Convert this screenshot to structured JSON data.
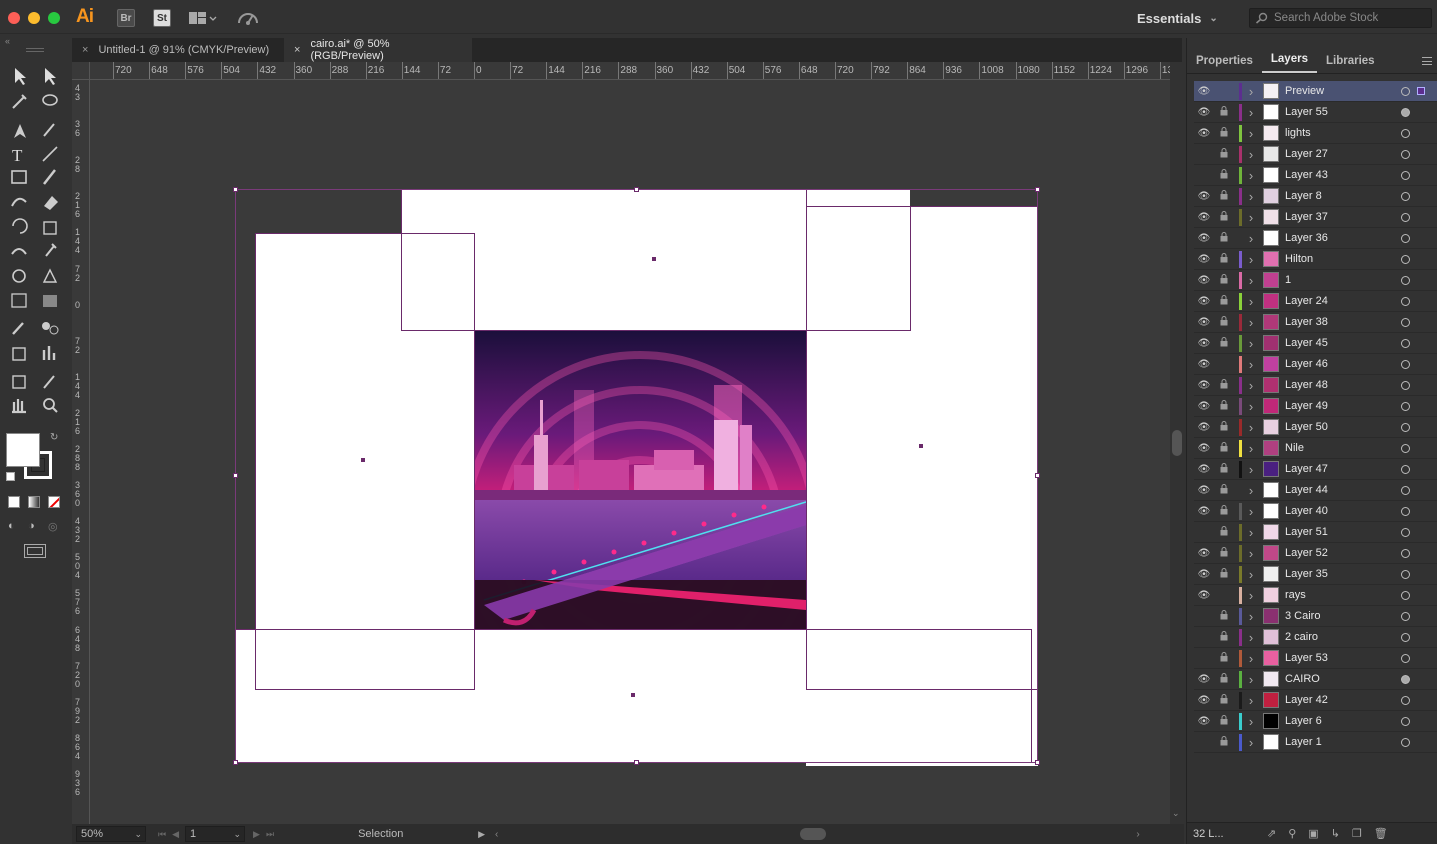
{
  "app": {
    "logo": "Ai",
    "bridge_label": "Br",
    "stock_label": "St",
    "workspace": "Essentials",
    "search_placeholder": "Search Adobe Stock"
  },
  "tabs": [
    {
      "label": "Untitled-1 @ 91% (CMYK/Preview)",
      "active": false
    },
    {
      "label": "cairo.ai* @ 50% (RGB/Preview)",
      "active": true
    }
  ],
  "ruler_h": [
    "720",
    "648",
    "576",
    "504",
    "432",
    "360",
    "288",
    "216",
    "144",
    "72",
    "0",
    "72",
    "144",
    "216",
    "288",
    "360",
    "432",
    "504",
    "576",
    "648",
    "720",
    "792",
    "864",
    "936",
    "1008",
    "1080",
    "1152",
    "1224",
    "1296",
    "13"
  ],
  "ruler_v": [
    "4 3",
    "3 6",
    "2 8",
    "2 1 6",
    "1 4 4",
    "7 2",
    "0",
    "7 2",
    "1 4 4",
    "2 1 6",
    "2 8 8",
    "3 6 0",
    "4 3 2",
    "5 0 4",
    "5 7 6",
    "6 4 8",
    "7 2 0",
    "7 9 2",
    "8 6 4",
    "9 3 6"
  ],
  "status": {
    "zoom": "50%",
    "artboard": "1",
    "tool": "Selection"
  },
  "panel": {
    "tabs": [
      "Properties",
      "Layers",
      "Libraries"
    ],
    "active_tab": "Layers",
    "layer_count": "32 L..."
  },
  "layers": [
    {
      "name": "Preview",
      "visible": true,
      "locked": false,
      "color": "#5c2e8f",
      "thumb": "#f4f0f4",
      "selected": true,
      "target": "open"
    },
    {
      "name": "Layer 55",
      "visible": true,
      "locked": true,
      "color": "#8a2f8a",
      "thumb": "#ffffff",
      "target": "filled"
    },
    {
      "name": "lights",
      "visible": true,
      "locked": true,
      "color": "#7fc43f",
      "thumb": "#f5eaf0",
      "target": "open"
    },
    {
      "name": "Layer 27",
      "visible": false,
      "locked": true,
      "color": "#a8316b",
      "thumb": "#e8e8e8",
      "target": "open"
    },
    {
      "name": "Layer 43",
      "visible": false,
      "locked": true,
      "color": "#6fb43a",
      "thumb": "#ffffff",
      "target": "open"
    },
    {
      "name": "Layer 8",
      "visible": true,
      "locked": true,
      "color": "#8a2f8a",
      "thumb": "#e0d0e0",
      "target": "open"
    },
    {
      "name": "Layer 37",
      "visible": true,
      "locked": true,
      "color": "#6c6c2a",
      "thumb": "#f0e0e8",
      "target": "open"
    },
    {
      "name": "Layer 36",
      "visible": true,
      "locked": true,
      "color": "#323232",
      "thumb": "#ffffff",
      "target": "open"
    },
    {
      "name": "Hilton",
      "visible": true,
      "locked": true,
      "color": "#7a5ccc",
      "thumb": "#e070b0",
      "target": "open"
    },
    {
      "name": "1",
      "visible": true,
      "locked": true,
      "color": "#d96aa5",
      "thumb": "#c04090",
      "target": "open"
    },
    {
      "name": "Layer 24",
      "visible": true,
      "locked": true,
      "color": "#8ad13a",
      "thumb": "#c03080",
      "target": "open"
    },
    {
      "name": "Layer 38",
      "visible": true,
      "locked": true,
      "color": "#9a2a3a",
      "thumb": "#b03878",
      "target": "open"
    },
    {
      "name": "Layer 45",
      "visible": true,
      "locked": true,
      "color": "#6a9a3a",
      "thumb": "#a03070",
      "target": "open"
    },
    {
      "name": "Layer 46",
      "visible": true,
      "locked": false,
      "color": "#e07a7a",
      "thumb": "#c040a0",
      "target": "open"
    },
    {
      "name": "Layer 48",
      "visible": true,
      "locked": true,
      "color": "#8a2f8a",
      "thumb": "#b03070",
      "target": "open"
    },
    {
      "name": "Layer 49",
      "visible": true,
      "locked": true,
      "color": "#7a4a7a",
      "thumb": "#c02878",
      "target": "open"
    },
    {
      "name": "Layer 50",
      "visible": true,
      "locked": true,
      "color": "#9a2a2a",
      "thumb": "#e8d0e0",
      "target": "open"
    },
    {
      "name": "Nile",
      "visible": true,
      "locked": true,
      "color": "#f0e040",
      "thumb": "#b04080",
      "target": "open"
    },
    {
      "name": "Layer 47",
      "visible": true,
      "locked": true,
      "color": "#111111",
      "thumb": "#4a2080",
      "target": "open"
    },
    {
      "name": "Layer 44",
      "visible": true,
      "locked": true,
      "color": "#323232",
      "thumb": "#ffffff",
      "target": "open"
    },
    {
      "name": "Layer 40",
      "visible": true,
      "locked": true,
      "color": "#5a5a5a",
      "thumb": "#ffffff",
      "target": "open"
    },
    {
      "name": "Layer 51",
      "visible": false,
      "locked": true,
      "color": "#6c6c2a",
      "thumb": "#f0d8e8",
      "target": "open"
    },
    {
      "name": "Layer 52",
      "visible": true,
      "locked": true,
      "color": "#6c6c2a",
      "thumb": "#c04888",
      "target": "open"
    },
    {
      "name": "Layer 35",
      "visible": true,
      "locked": true,
      "color": "#7a7a2a",
      "thumb": "#f0f0f0",
      "target": "open"
    },
    {
      "name": "rays",
      "visible": true,
      "locked": false,
      "color": "#d8b0a0",
      "thumb": "#f0d0e0",
      "target": "open"
    },
    {
      "name": "3 Cairo",
      "visible": false,
      "locked": true,
      "color": "#5a5a9a",
      "thumb": "#8a3070",
      "target": "open"
    },
    {
      "name": "2 cairo",
      "visible": false,
      "locked": true,
      "color": "#8a2f8a",
      "thumb": "#e0c0d8",
      "target": "open"
    },
    {
      "name": "Layer 53",
      "visible": false,
      "locked": true,
      "color": "#b05a3a",
      "thumb": "#e860a0",
      "target": "open"
    },
    {
      "name": "CAIRO",
      "visible": true,
      "locked": true,
      "color": "#5ab040",
      "thumb": "#f0e8f0",
      "target": "filled"
    },
    {
      "name": "Layer 42",
      "visible": true,
      "locked": true,
      "color": "#1a1a1a",
      "thumb": "#c02040",
      "target": "open"
    },
    {
      "name": "Layer 6",
      "visible": true,
      "locked": true,
      "color": "#3acccc",
      "thumb": "#000000",
      "target": "open"
    },
    {
      "name": "Layer 1",
      "visible": false,
      "locked": true,
      "color": "#4a5acc",
      "thumb": "#ffffff",
      "target": "open"
    }
  ]
}
